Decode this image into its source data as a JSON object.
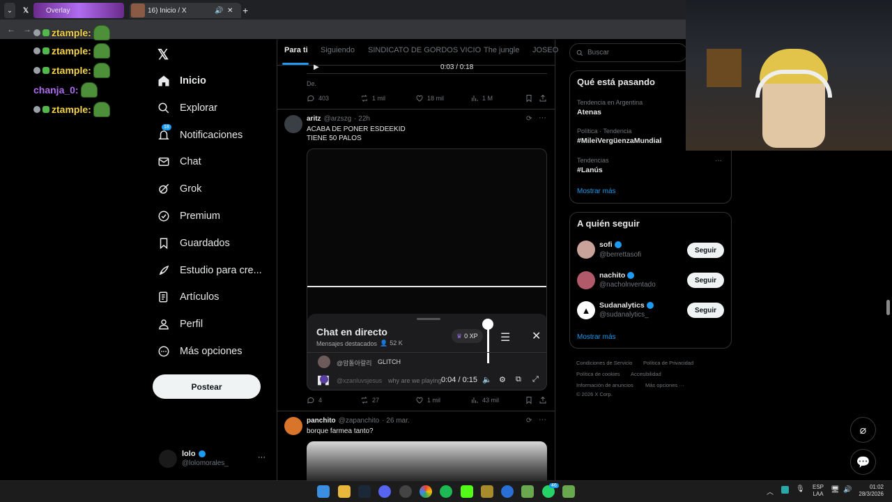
{
  "browser": {
    "tabs": [
      {
        "label": "Overlay"
      },
      {
        "label": "16) Inicio / X"
      }
    ],
    "new_tab": "+"
  },
  "overlay_chat": [
    {
      "user": "ztample:",
      "color": "#f5d547"
    },
    {
      "user": "ztample:",
      "color": "#f5d547"
    },
    {
      "user": "ztample:",
      "color": "#f5d547"
    },
    {
      "user": "chanja_0:",
      "color": "#b06cf0"
    },
    {
      "user": "ztample:",
      "color": "#f5d547"
    }
  ],
  "nav": {
    "items": [
      {
        "label": "Inicio",
        "icon": "home-icon"
      },
      {
        "label": "Explorar",
        "icon": "search-icon"
      },
      {
        "label": "Notificaciones",
        "icon": "bell-icon",
        "badge": "18"
      },
      {
        "label": "Chat",
        "icon": "mail-icon"
      },
      {
        "label": "Grok",
        "icon": "grok-icon"
      },
      {
        "label": "Premium",
        "icon": "verified-icon"
      },
      {
        "label": "Guardados",
        "icon": "bookmark-icon"
      },
      {
        "label": "Estudio para cre...",
        "icon": "rocket-icon"
      },
      {
        "label": "Artículos",
        "icon": "article-icon"
      },
      {
        "label": "Perfil",
        "icon": "person-icon"
      },
      {
        "label": "Más opciones",
        "icon": "more-circle-icon"
      }
    ],
    "post_button": "Postear",
    "account": {
      "name": "lolo",
      "handle": "@lolomorales_",
      "more": "···"
    }
  },
  "feed": {
    "tabs": [
      "Para ti",
      "Siguiendo",
      "SINDICATO DE GORDOS VICIO",
      "The jungle",
      "JOSEO"
    ],
    "prev_post": {
      "player_time": "0:03 / 0:18",
      "text": "De.",
      "replies": "403",
      "reposts": "1 mil",
      "likes": "18 mil",
      "views": "1 M"
    },
    "post1": {
      "name": "aritz",
      "handle": "@arzszg",
      "time": "· 22h",
      "line1": "ACABA DE PONER ESDEEKID",
      "line2": "TIENE 50 PALOS",
      "live_chat_title": "Chat en directo",
      "live_chat_sub": "Mensajes destacados",
      "viewers": "52 K",
      "xp": "0 XP",
      "chat_user": "@암돌아랄리",
      "chat_msg": "GLITCH",
      "chat_user2": "@xzanluvsjesus",
      "chat_msg2": "why are we playing",
      "player_time": "0:04 / 0:15",
      "replies": "4",
      "reposts": "27",
      "likes": "1 mil",
      "views": "43 mil"
    },
    "post2": {
      "name": "panchito",
      "handle": "@zapanchito",
      "time": "· 26 mar.",
      "text": "borque farmea tanto?"
    }
  },
  "sidebar": {
    "search_placeholder": "Buscar",
    "trending_title": "Qué está pasando",
    "trends": [
      {
        "context": "Tendencia en Argentina",
        "name": "Atenas"
      },
      {
        "context": "Política · Tendencia",
        "name": "#MileiVergüenzaMundial"
      },
      {
        "context": "Tendencias",
        "name": "#Lanús"
      }
    ],
    "show_more": "Mostrar más",
    "follow_title": "A quién seguir",
    "follow": [
      {
        "name": "sofi",
        "handle": "@berrettasofi",
        "button": "Seguir"
      },
      {
        "name": "nachito",
        "handle": "@nacholnventado",
        "button": "Seguir"
      },
      {
        "name": "Sudanalytics",
        "handle": "@sudanalytics_",
        "button": "Seguir"
      }
    ],
    "show_more2": "Mostrar más",
    "footer": {
      "l1": "Condiciones de Servicio",
      "l2": "Política de Privacidad",
      "l3": "Política de cookies",
      "l4": "Accesibilidad",
      "l5": "Información de anuncios",
      "l6": "Más opciones ···",
      "copy": "© 2026 X Corp."
    }
  },
  "taskbar": {
    "lang1": "ESP",
    "lang2": "LAA",
    "time": "01:02",
    "date": "28/3/2026",
    "whatsapp_badge": "46"
  },
  "colors": {
    "accent": "#1d9bf0",
    "bg": "#000000",
    "border": "#2f3336"
  }
}
